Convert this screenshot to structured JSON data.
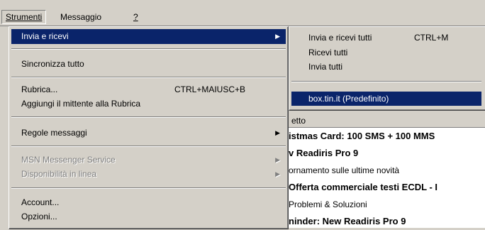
{
  "menubar": {
    "items": [
      {
        "label": "Strumenti"
      },
      {
        "label": "Messaggio"
      },
      {
        "label": "?"
      }
    ]
  },
  "main_menu": {
    "invia_ricevi": "Invia e ricevi",
    "sincronizza": "Sincronizza tutto",
    "rubrica": "Rubrica...",
    "rubrica_shortcut": "CTRL+MAIUSC+B",
    "aggiungi": "Aggiungi il mittente alla Rubrica",
    "regole": "Regole messaggi",
    "msn": "MSN Messenger Service",
    "disponibilita": "Disponibilità in linea",
    "account": "Account...",
    "opzioni": "Opzioni..."
  },
  "sub_menu": {
    "invia_ricevi_tutti": "Invia e ricevi tutti",
    "invia_ricevi_tutti_shortcut": "CTRL+M",
    "ricevi_tutti": "Ricevi tutti",
    "invia_tutti": "Invia tutti",
    "account_predefinito": "box.tin.it (Predefinito)"
  },
  "message_list": {
    "header": "etto",
    "rows": [
      {
        "subject": "istmas Card: 100 SMS + 100 MMS",
        "bold": true
      },
      {
        "subject": "v Readiris Pro 9",
        "bold": true
      },
      {
        "subject": "ornamento sulle ultime novità",
        "bold": false
      },
      {
        "subject": "Offerta commerciale testi ECDL - I",
        "bold": true
      },
      {
        "subject": "Problemi & Soluzioni",
        "bold": false
      },
      {
        "subject": "ninder: New Readiris Pro 9",
        "bold": true
      }
    ]
  },
  "colors": {
    "highlight": "#0a246a",
    "face": "#d4d0c8"
  }
}
